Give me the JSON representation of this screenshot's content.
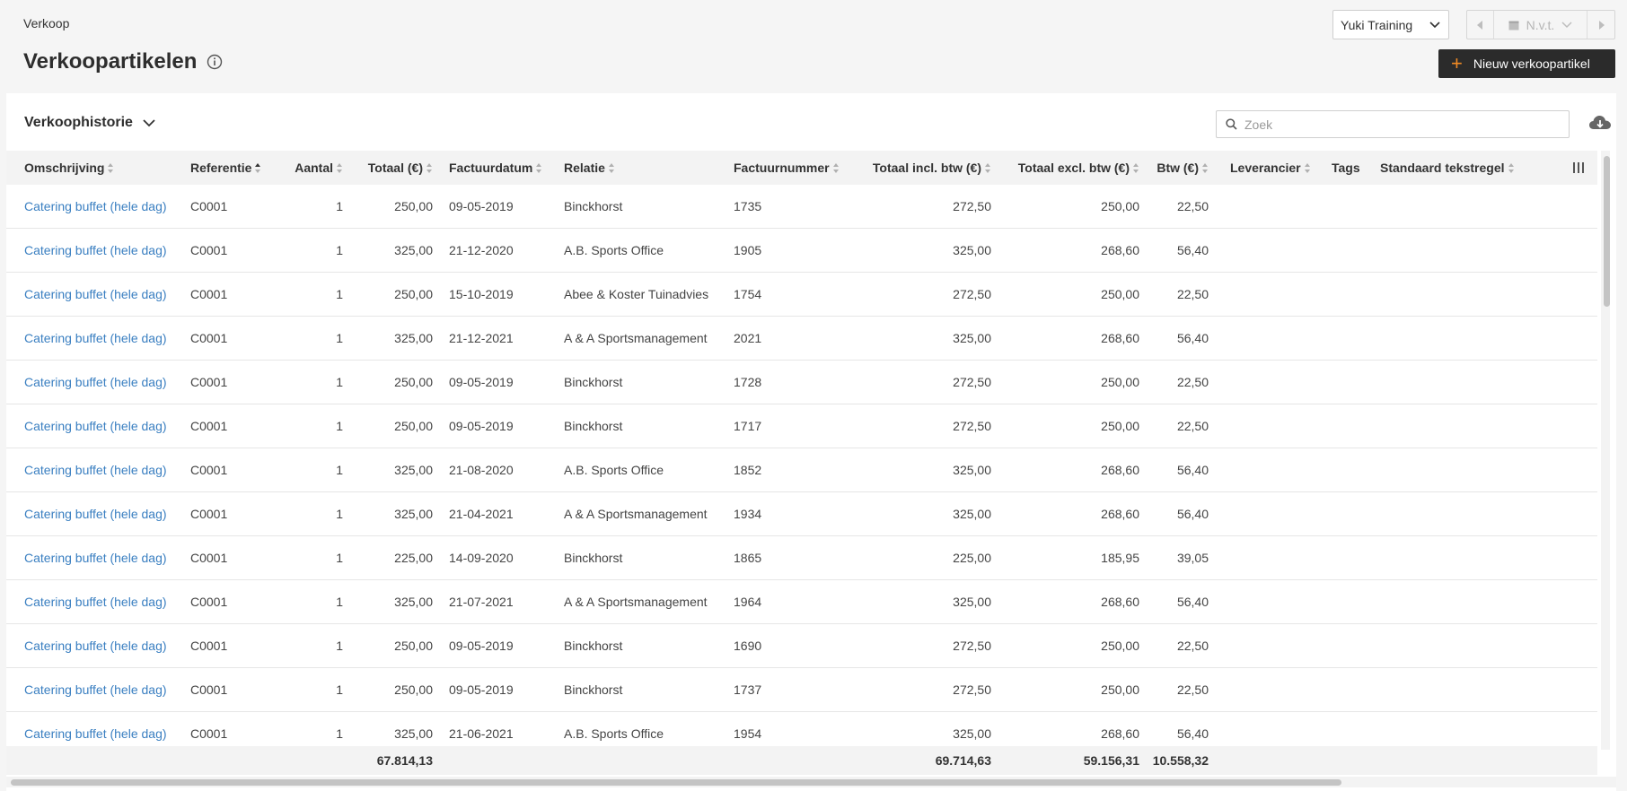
{
  "header": {
    "breadcrumb": "Verkoop",
    "title": "Verkoopartikelen",
    "admin_select": "Yuki Training",
    "period_label": "N.v.t.",
    "new_button": "Nieuw verkoopartikel"
  },
  "toolbar": {
    "history_label": "Verkoophistorie",
    "search_placeholder": "Zoek"
  },
  "table": {
    "columns": [
      "Omschrijving",
      "Referentie",
      "Aantal",
      "Totaal (€)",
      "Factuurdatum",
      "Relatie",
      "Factuurnummer",
      "Totaal incl. btw (€)",
      "Totaal excl. btw (€)",
      "Btw (€)",
      "Leverancier",
      "Tags",
      "Standaard tekstregel"
    ],
    "rows": [
      [
        "Catering buffet (hele dag)",
        "C0001",
        "1",
        "250,00",
        "09-05-2019",
        "Binckhorst",
        "1735",
        "272,50",
        "250,00",
        "22,50"
      ],
      [
        "Catering buffet (hele dag)",
        "C0001",
        "1",
        "325,00",
        "21-12-2020",
        "A.B. Sports Office",
        "1905",
        "325,00",
        "268,60",
        "56,40"
      ],
      [
        "Catering buffet (hele dag)",
        "C0001",
        "1",
        "250,00",
        "15-10-2019",
        "Abee & Koster Tuinadvies",
        "1754",
        "272,50",
        "250,00",
        "22,50"
      ],
      [
        "Catering buffet (hele dag)",
        "C0001",
        "1",
        "325,00",
        "21-12-2021",
        "A & A Sportsmanagement",
        "2021",
        "325,00",
        "268,60",
        "56,40"
      ],
      [
        "Catering buffet (hele dag)",
        "C0001",
        "1",
        "250,00",
        "09-05-2019",
        "Binckhorst",
        "1728",
        "272,50",
        "250,00",
        "22,50"
      ],
      [
        "Catering buffet (hele dag)",
        "C0001",
        "1",
        "250,00",
        "09-05-2019",
        "Binckhorst",
        "1717",
        "272,50",
        "250,00",
        "22,50"
      ],
      [
        "Catering buffet (hele dag)",
        "C0001",
        "1",
        "325,00",
        "21-08-2020",
        "A.B. Sports Office",
        "1852",
        "325,00",
        "268,60",
        "56,40"
      ],
      [
        "Catering buffet (hele dag)",
        "C0001",
        "1",
        "325,00",
        "21-04-2021",
        "A & A Sportsmanagement",
        "1934",
        "325,00",
        "268,60",
        "56,40"
      ],
      [
        "Catering buffet (hele dag)",
        "C0001",
        "1",
        "225,00",
        "14-09-2020",
        "Binckhorst",
        "1865",
        "225,00",
        "185,95",
        "39,05"
      ],
      [
        "Catering buffet (hele dag)",
        "C0001",
        "1",
        "325,00",
        "21-07-2021",
        "A & A Sportsmanagement",
        "1964",
        "325,00",
        "268,60",
        "56,40"
      ],
      [
        "Catering buffet (hele dag)",
        "C0001",
        "1",
        "250,00",
        "09-05-2019",
        "Binckhorst",
        "1690",
        "272,50",
        "250,00",
        "22,50"
      ],
      [
        "Catering buffet (hele dag)",
        "C0001",
        "1",
        "250,00",
        "09-05-2019",
        "Binckhorst",
        "1737",
        "272,50",
        "250,00",
        "22,50"
      ],
      [
        "Catering buffet (hele dag)",
        "C0001",
        "1",
        "325,00",
        "21-06-2021",
        "A.B. Sports Office",
        "1954",
        "325,00",
        "268,60",
        "56,40"
      ]
    ],
    "totals": {
      "totaal": "67.814,13",
      "incl": "69.714,63",
      "excl": "59.156,31",
      "btw": "10.558,32"
    }
  },
  "colors": {
    "link": "#3a7fc1",
    "primary_button": "#2b2b2b",
    "accent": "#f08a24"
  }
}
